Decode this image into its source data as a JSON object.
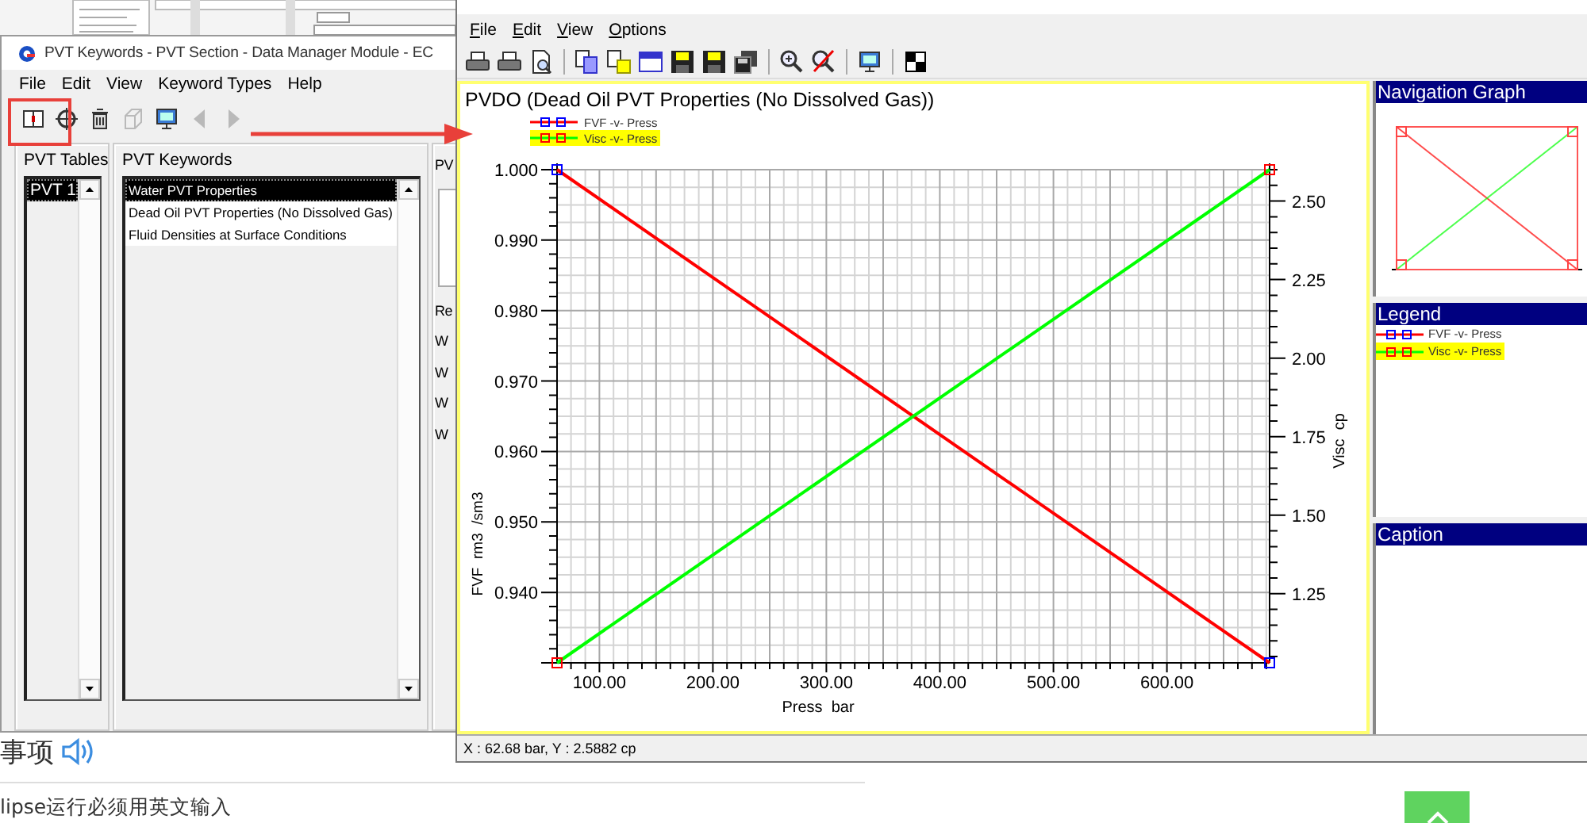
{
  "pvt_window": {
    "title": "PVT Keywords - PVT Section - Data Manager Module - EC",
    "menu": [
      "File",
      "Edit",
      "View",
      "Keyword Types",
      "Help"
    ],
    "toolbar": [
      {
        "kind": "book",
        "disabled": false
      },
      {
        "kind": "crosshair",
        "disabled": false
      },
      {
        "kind": "trash",
        "disabled": false
      },
      {
        "kind": "cube",
        "disabled": true
      },
      {
        "kind": "monitor",
        "disabled": false
      },
      {
        "kind": "arrow-left",
        "disabled": true
      },
      {
        "kind": "arrow-right",
        "disabled": true
      }
    ],
    "tables": {
      "label": "PVT Tables",
      "items": [
        {
          "text": "PVT 1",
          "selected": true
        }
      ]
    },
    "keywords": {
      "label": "PVT Keywords",
      "items": [
        {
          "text": "Water PVT Properties",
          "selected": true
        },
        {
          "text": "Dead Oil PVT Properties (No Dissolved Gas)",
          "selected": false
        },
        {
          "text": "Fluid Densities at Surface Conditions",
          "selected": false
        }
      ]
    },
    "panel_3": {
      "label": "PV",
      "lines": [
        "Re",
        "W",
        "W",
        "W",
        "W"
      ]
    }
  },
  "plot_window": {
    "menu": [
      "File",
      "Edit",
      "View",
      "Options"
    ],
    "toolbar": [
      {
        "kind": "printer",
        "disabled": false
      },
      {
        "kind": "printer",
        "disabled": false
      },
      {
        "kind": "preview",
        "disabled": false
      },
      {
        "kind": "separator"
      },
      {
        "kind": "copy",
        "disabled": false
      },
      {
        "kind": "paste",
        "disabled": false
      },
      {
        "kind": "window",
        "disabled": false
      },
      {
        "kind": "disk",
        "disabled": false
      },
      {
        "kind": "disk",
        "disabled": false
      },
      {
        "kind": "disks",
        "disabled": false
      },
      {
        "kind": "separator"
      },
      {
        "kind": "zoom-in",
        "disabled": false
      },
      {
        "kind": "zoom-cross",
        "disabled": false
      },
      {
        "kind": "separator"
      },
      {
        "kind": "monitor",
        "disabled": false
      },
      {
        "kind": "separator"
      },
      {
        "kind": "checker",
        "disabled": false
      }
    ],
    "chart_data": {
      "type": "line",
      "title": "PVDO (Dead Oil PVT Properties (No Dissolved Gas))",
      "xlabel": "Press  bar",
      "ylabel": "FVF  rm3  /sm3",
      "y2label": "Visc  cp",
      "x": [
        62.68,
        690.5
      ],
      "series": [
        {
          "name": "FVF -v- Press",
          "color": "#ff0000",
          "marker": "square",
          "values": [
            1.0,
            0.93
          ]
        },
        {
          "name": "Visc -v- Press",
          "color": "#00ff00",
          "marker": "square",
          "axis": "y2",
          "values": [
            1.03,
            2.6
          ]
        }
      ],
      "grid": true,
      "legend": true,
      "xlim": [
        62.68,
        690.5
      ],
      "ylim": [
        0.93,
        1.0
      ],
      "y2lim": [
        1.03,
        2.6
      ],
      "xticks": [
        {
          "value": 100,
          "label": "100.00"
        },
        {
          "value": 200,
          "label": "200.00"
        },
        {
          "value": 300,
          "label": "300.00"
        },
        {
          "value": 400,
          "label": "400.00"
        },
        {
          "value": 500,
          "label": "500.00"
        },
        {
          "value": 600,
          "label": "600.00"
        }
      ],
      "yticks": [
        {
          "value": 0.94,
          "label": "0.940"
        },
        {
          "value": 0.95,
          "label": "0.950"
        },
        {
          "value": 0.96,
          "label": "0.960"
        },
        {
          "value": 0.97,
          "label": "0.970"
        },
        {
          "value": 0.98,
          "label": "0.980"
        },
        {
          "value": 0.99,
          "label": "0.990"
        },
        {
          "value": 1.0,
          "label": "1.000"
        }
      ],
      "y2ticks": [
        {
          "value": 1.25,
          "label": "1.25"
        },
        {
          "value": 1.5,
          "label": "1.50"
        },
        {
          "value": 1.75,
          "label": "1.75"
        },
        {
          "value": 2.0,
          "label": "2.00"
        },
        {
          "value": 2.25,
          "label": "2.25"
        },
        {
          "value": 2.5,
          "label": "2.50"
        }
      ]
    },
    "chart_legend": [
      {
        "selected": false
      },
      {
        "selected": true
      }
    ],
    "navigation": {
      "title": "Navigation Graph"
    },
    "legend_panel": {
      "title": "Legend",
      "items": [
        {
          "text": "FVF -v- Press",
          "color": "#ff0000",
          "selected": false
        },
        {
          "text": "Visc -v- Press",
          "color": "#00ff00",
          "selected": true
        }
      ]
    },
    "caption": {
      "title": "Caption"
    },
    "status": "X : 62.68 bar, Y : 2.5882 cp"
  },
  "page": {
    "heading": "事项",
    "note": "lipse运行必须用英文输入"
  }
}
